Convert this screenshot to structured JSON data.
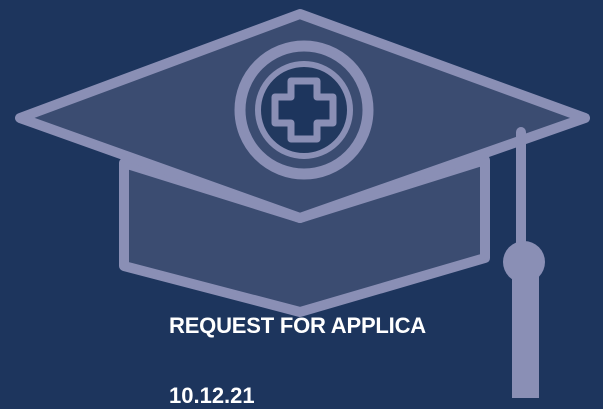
{
  "banner": {
    "headline": "REQUEST FOR APPLICA",
    "date_partial": "10.12.21"
  },
  "icons": {
    "main": "graduation-cap-icon",
    "emblem": "medical-cross-icon"
  },
  "colors": {
    "background": "#1d355d",
    "icon_stroke": "#8a8fb5",
    "icon_fill": "#3b4c71",
    "text": "#ffffff"
  }
}
